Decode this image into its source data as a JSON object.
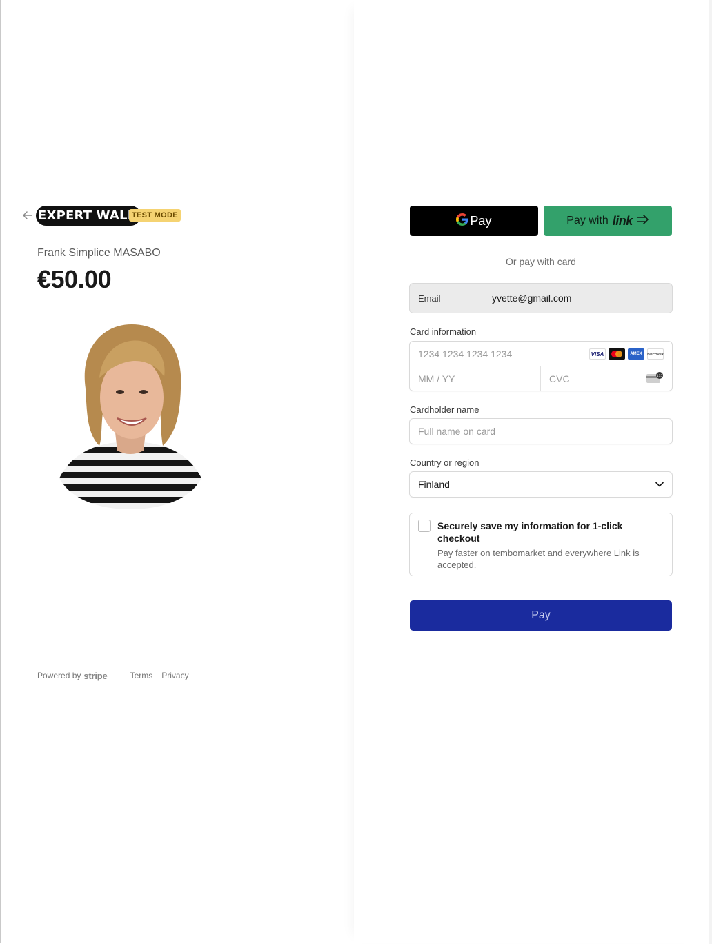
{
  "header": {
    "brand_name": "EXPERT WALL",
    "test_mode_badge": "TEST MODE"
  },
  "product": {
    "name": "Frank Simplice MASABO",
    "price": "€50.00"
  },
  "footer": {
    "powered_by": "Powered by",
    "stripe_label": "stripe",
    "terms": "Terms",
    "privacy": "Privacy"
  },
  "express_pay": {
    "gpay_label": "Pay",
    "link_prefix": "Pay with",
    "link_word": "link"
  },
  "divider_text": "Or pay with card",
  "email": {
    "label": "Email",
    "value": "yvette@gmail.com"
  },
  "card": {
    "label": "Card information",
    "number_placeholder": "1234 1234 1234 1234",
    "expiry_placeholder": "MM / YY",
    "cvc_placeholder": "CVC",
    "brands": [
      "VISA",
      "",
      "AMEX",
      "DISCOVER"
    ]
  },
  "cardholder": {
    "label": "Cardholder name",
    "placeholder": "Full name on card"
  },
  "country": {
    "label": "Country or region",
    "value": "Finland"
  },
  "save_info": {
    "title": "Securely save my information for 1-click checkout",
    "description": "Pay faster on tembomarket and everywhere Link is accepted."
  },
  "pay_button": "Pay",
  "colors": {
    "pay_button": "#1a2b9e",
    "link_button": "#33a16b",
    "test_badge": "#f5d372"
  }
}
